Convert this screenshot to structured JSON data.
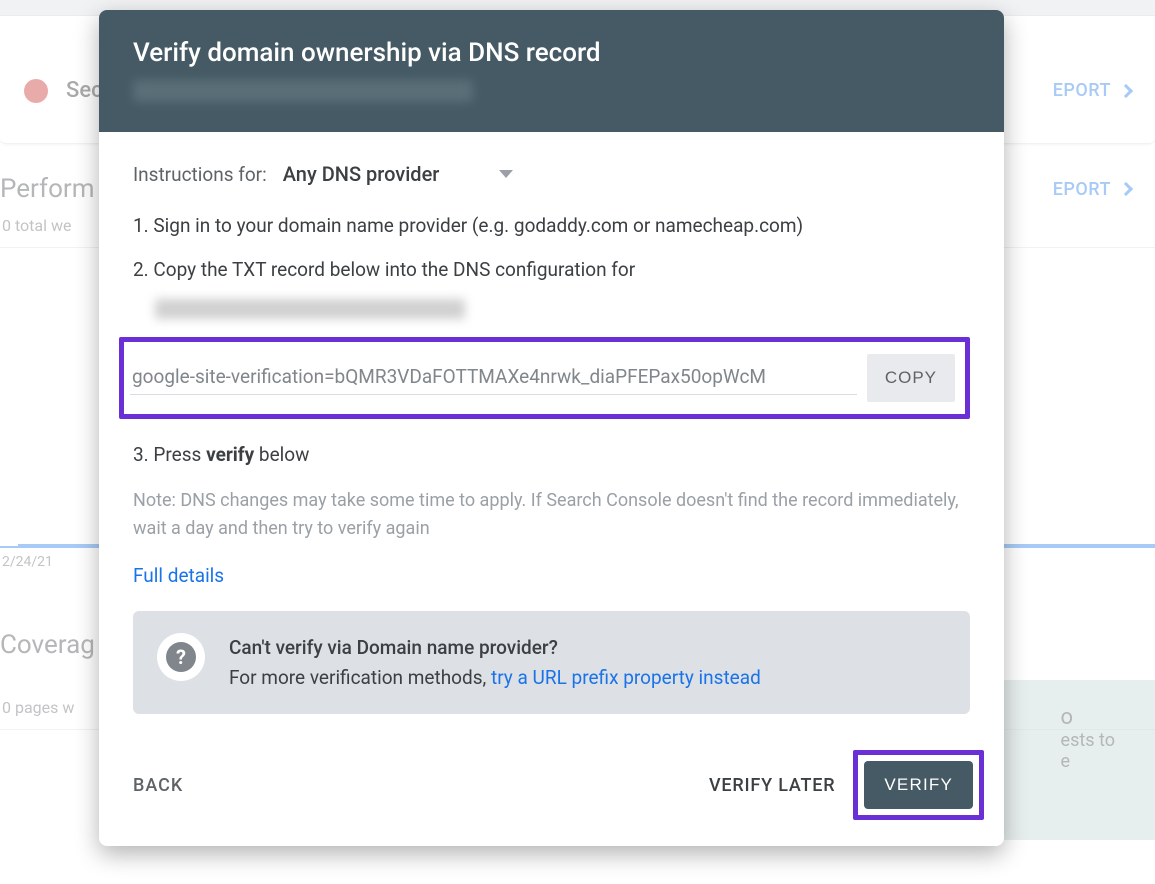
{
  "bg": {
    "security_title": "Secur",
    "report_link": "EPORT",
    "perf_title": "Perform",
    "perf_sub": "0 total we",
    "date": "2/24/21",
    "coverage_title": "Coverag",
    "coverage_sub": "0 pages w",
    "right_text1": "ests to",
    "right_text2": "e",
    "right_text3": "o"
  },
  "dialog": {
    "title": "Verify domain ownership via DNS record",
    "instructions_label": "Instructions for:",
    "provider": "Any DNS provider",
    "step1": "1. Sign in to your domain name provider (e.g. godaddy.com or namecheap.com)",
    "step2": "2. Copy the TXT record below into the DNS configuration for",
    "txt_value": "google-site-verification=bQMR3VDaFOTTMAXe4nrwk_diaPFEPax50opWcM",
    "copy_label": "COPY",
    "step3_prefix": "3. Press ",
    "step3_bold": "verify",
    "step3_suffix": " below",
    "note": "Note: DNS changes may take some time to apply. If Search Console doesn't find the record immediately, wait a day and then try to verify again",
    "full_details": "Full details",
    "info_heading": "Can't verify via Domain name provider?",
    "info_text": "For more verification methods, ",
    "info_link": "try a URL prefix property instead",
    "back_label": "BACK",
    "verify_later_label": "VERIFY LATER",
    "verify_label": "VERIFY"
  }
}
